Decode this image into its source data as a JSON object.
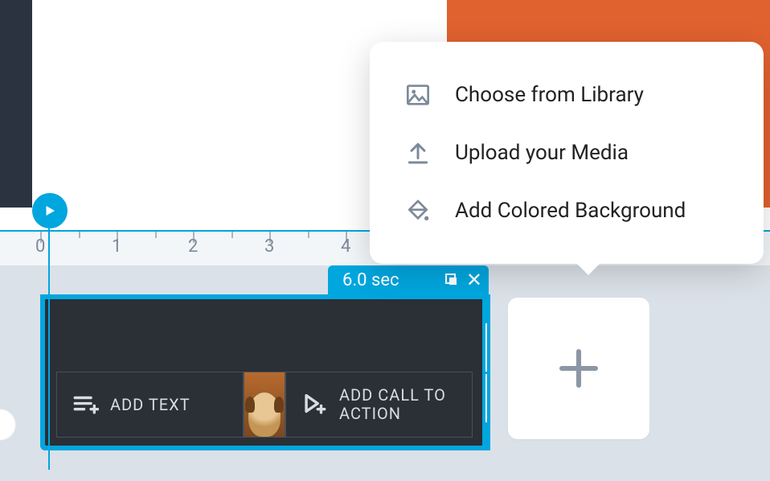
{
  "popover": {
    "items": [
      {
        "label": "Choose from Library",
        "icon": "image-icon"
      },
      {
        "label": "Upload your Media",
        "icon": "upload-icon"
      },
      {
        "label": "Add Colored Background",
        "icon": "paint-icon"
      }
    ]
  },
  "ruler": {
    "ticks": [
      "0",
      "1",
      "2",
      "3",
      "4"
    ]
  },
  "clip": {
    "duration_label": "6.0 sec",
    "add_text_label": "ADD TEXT",
    "add_cta_label": "ADD CALL TO ACTION"
  },
  "add_tile": {
    "tooltip": "Add"
  }
}
